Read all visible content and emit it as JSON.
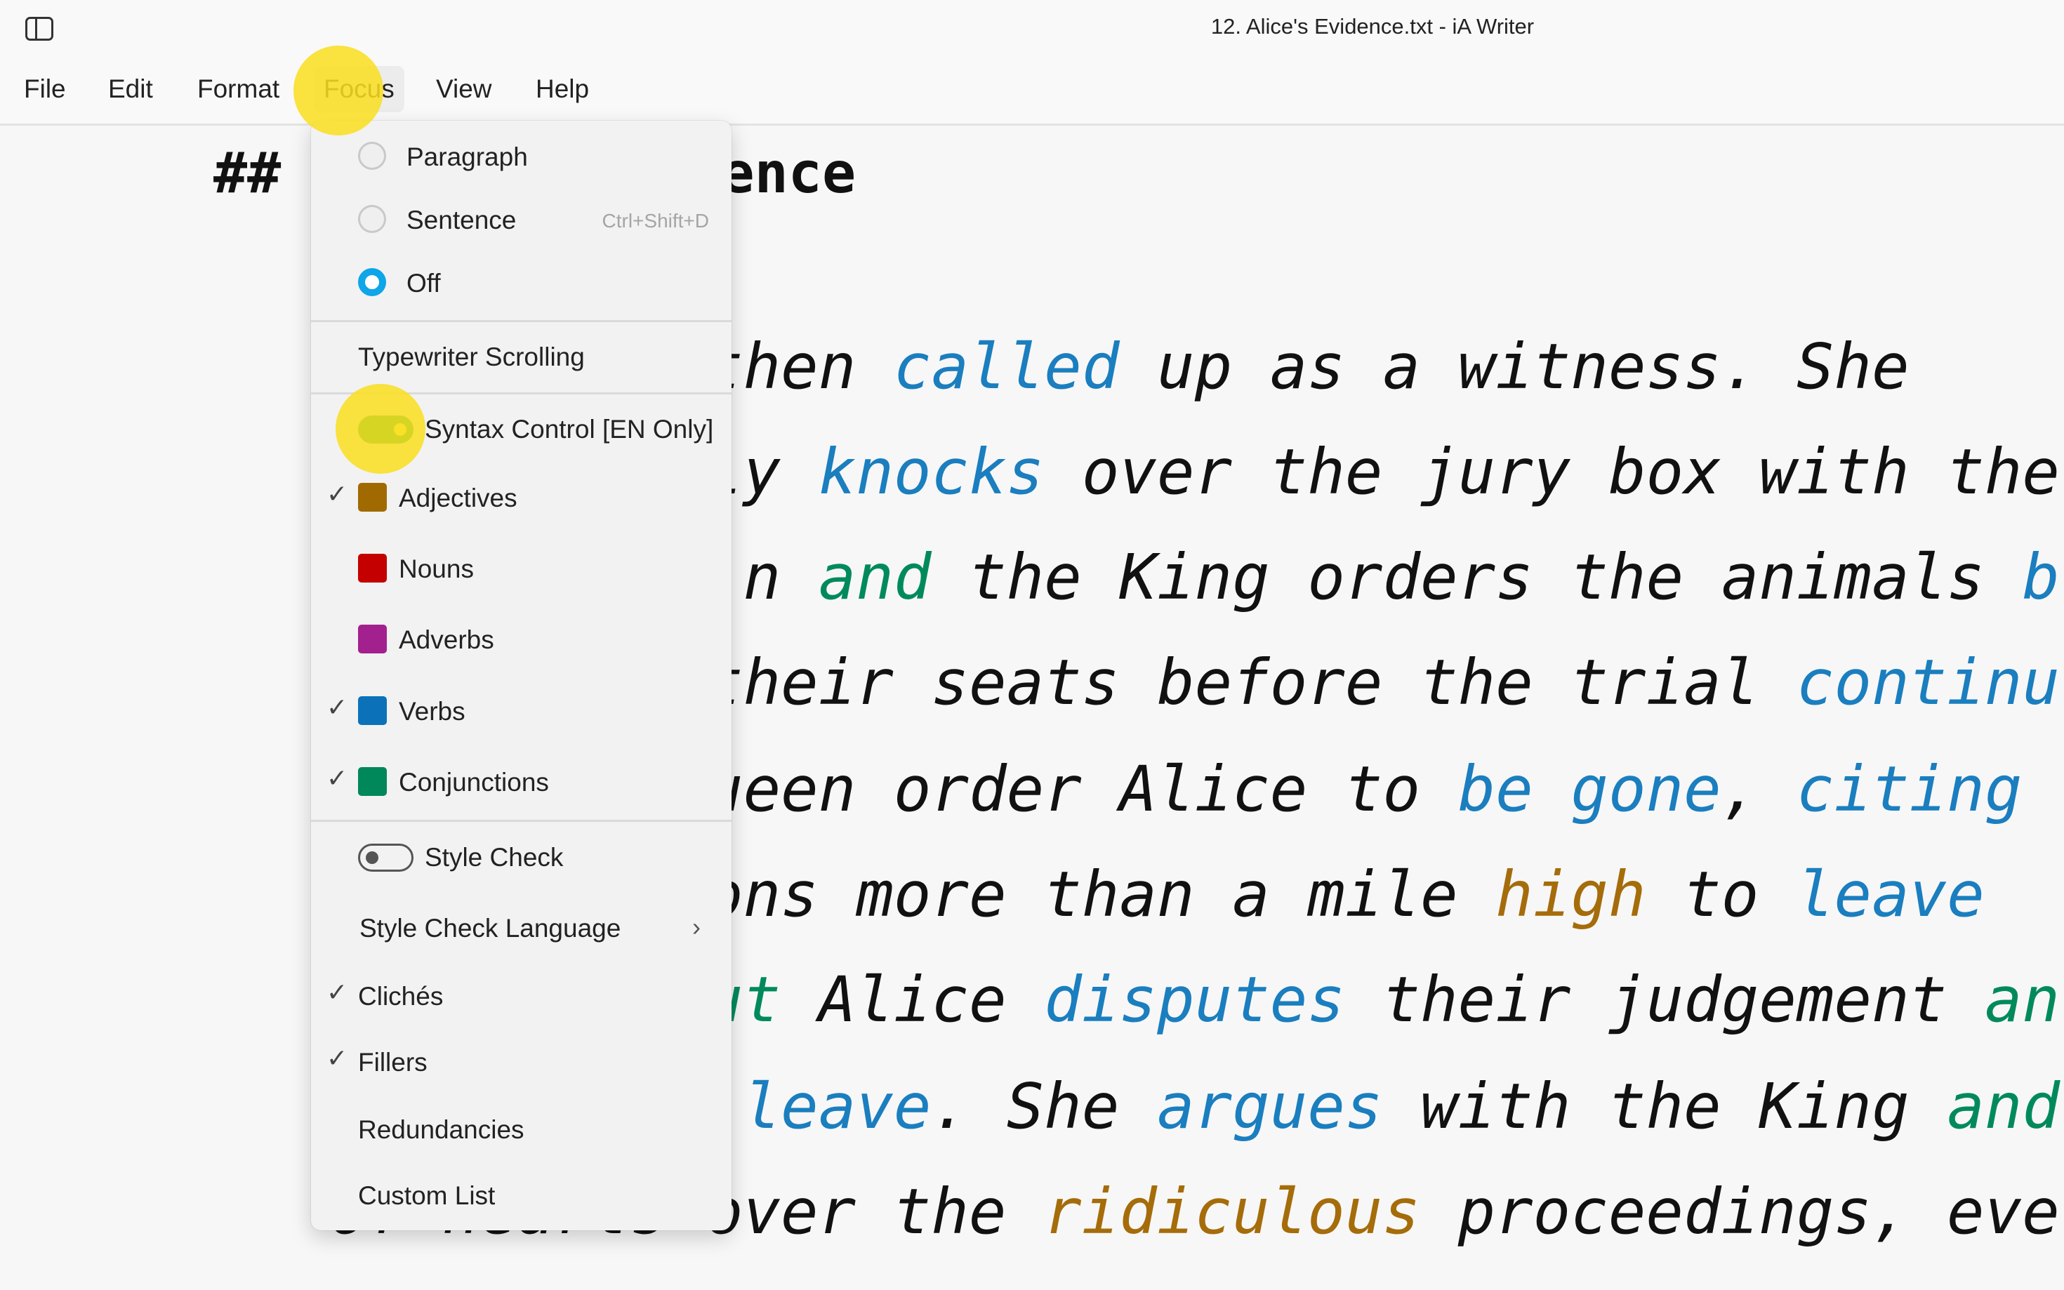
{
  "window": {
    "title": "12. Alice's Evidence.txt - iA Writer"
  },
  "menubar": {
    "items": [
      "File",
      "Edit",
      "Format",
      "Focus",
      "View",
      "Help"
    ],
    "active": "Focus"
  },
  "document": {
    "heading": "## Alice's Evidence",
    "lines": [
      [
        {
          "t": "then "
        },
        {
          "t": "called",
          "c": "verb"
        },
        {
          "t": " up as a witness. She"
        }
      ],
      [
        {
          "t": "ly "
        },
        {
          "t": "knocks",
          "c": "verb"
        },
        {
          "t": " over the jury box with the"
        }
      ],
      [
        {
          "t": "n "
        },
        {
          "t": "and",
          "c": "conj"
        },
        {
          "t": " the King orders the animals "
        },
        {
          "t": "b",
          "c": "verb"
        }
      ],
      [
        {
          "t": "their seats before the trial "
        },
        {
          "t": "continu",
          "c": "verb"
        }
      ],
      [
        {
          "t": "ueen order Alice to "
        },
        {
          "t": "be gone",
          "c": "verb"
        },
        {
          "t": ", "
        },
        {
          "t": "citing",
          "c": "verb"
        }
      ],
      [
        {
          "t": "ons more than a mile "
        },
        {
          "t": "high",
          "c": "adj"
        },
        {
          "t": " to "
        },
        {
          "t": "leave",
          "c": "verb"
        }
      ],
      [
        {
          "t": "ut",
          "c": "conj"
        },
        {
          "t": " Alice "
        },
        {
          "t": "disputes",
          "c": "verb"
        },
        {
          "t": " their judgement "
        },
        {
          "t": "an",
          "c": "conj"
        }
      ],
      [
        {
          "t": "leave",
          "c": "verb"
        },
        {
          "t": ". She "
        },
        {
          "t": "argues",
          "c": "verb"
        },
        {
          "t": " with the King "
        },
        {
          "t": "and",
          "c": "conj"
        }
      ],
      [
        {
          "t": "of hearts over the "
        },
        {
          "t": "ridiculous",
          "c": "adj"
        },
        {
          "t": " proceedings, eve"
        }
      ]
    ]
  },
  "focus_menu": {
    "focus_modes": [
      {
        "label": "Paragraph",
        "selected": false
      },
      {
        "label": "Sentence",
        "selected": false,
        "shortcut": "Ctrl+Shift+D"
      },
      {
        "label": "Off",
        "selected": true
      }
    ],
    "typewriter_scrolling": "Typewriter Scrolling",
    "syntax_control": {
      "label": "Syntax Control [EN Only]",
      "on": true
    },
    "syntax_items": [
      {
        "label": "Adjectives",
        "checked": true,
        "color": "#a06a00"
      },
      {
        "label": "Nouns",
        "checked": false,
        "color": "#c40000"
      },
      {
        "label": "Adverbs",
        "checked": false,
        "color": "#a3218f"
      },
      {
        "label": "Verbs",
        "checked": true,
        "color": "#0b72b9"
      },
      {
        "label": "Conjunctions",
        "checked": true,
        "color": "#00875a"
      }
    ],
    "style_check": {
      "label": "Style Check",
      "on": false
    },
    "style_check_language": "Style Check Language",
    "style_items": [
      {
        "label": "Clichés",
        "checked": true
      },
      {
        "label": "Fillers",
        "checked": true
      },
      {
        "label": "Redundancies",
        "checked": false
      },
      {
        "label": "Custom List",
        "checked": false
      }
    ],
    "check_glyph": "✓",
    "chevron_glyph": "›"
  }
}
